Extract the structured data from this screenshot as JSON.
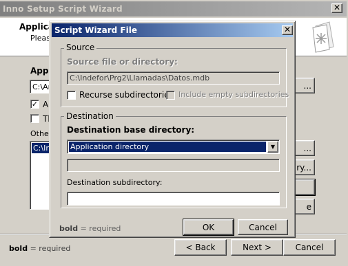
{
  "outer_window": {
    "title": "Inno Setup Script Wizard",
    "close_glyph": "✕",
    "header": {
      "title_partial": "Applicat",
      "subtitle_partial": "Please"
    },
    "section_label_partial": "Appli",
    "path_field_partial": "C:\\Arc",
    "checkbox1_partial": "All",
    "checkbox2_partial": "Th",
    "other_label_partial": "Other a",
    "list_item_partial": "C:\\Ind",
    "right_btn_partials": [
      "...",
      "...",
      "ry...",
      "",
      "e"
    ],
    "footer_required_bold": "bold",
    "footer_required_rest": " = required",
    "back_button": "< Back",
    "next_button": "Next >",
    "cancel_button": "Cancel"
  },
  "dialog": {
    "title": "Script Wizard File",
    "close_glyph": "✕",
    "source": {
      "legend": "Source",
      "file_label": "Source file or directory:",
      "file_value": "C:\\Indefor\\Prg2\\Llamadas\\Datos.mdb",
      "recurse_label": "Recurse subdirectories",
      "include_empty_label": "Include empty subdirectories"
    },
    "destination": {
      "legend": "Destination",
      "base_dir_label": "Destination base directory:",
      "base_dir_value": "Application directory",
      "subdir_label": "Destination subdirectory:",
      "subdir_value": ""
    },
    "required_bold": "bold",
    "required_rest": " = required",
    "ok_button": "OK",
    "cancel_button": "Cancel"
  }
}
